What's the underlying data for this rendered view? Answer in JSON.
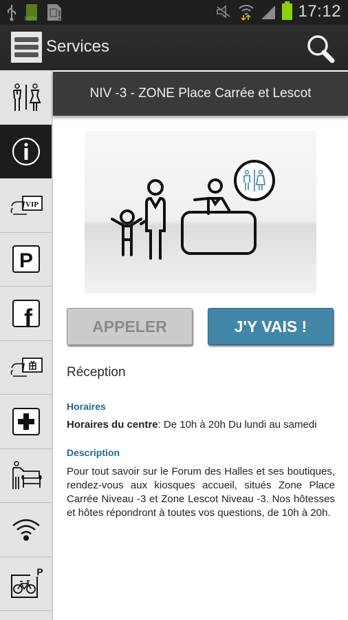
{
  "status_bar": {
    "battery_small_label": "100%",
    "time": "17:12",
    "icons": [
      "usb-icon",
      "battery-icon",
      "sim-alert-icon",
      "mute-icon",
      "wifi-icon",
      "signal-icon",
      "battery-icon"
    ]
  },
  "action_bar": {
    "title": "Services",
    "menu_icon": "hamburger-icon",
    "search_icon": "search-icon"
  },
  "sidebar": {
    "items": [
      {
        "id": "toilets",
        "icon": "toilets-icon"
      },
      {
        "id": "info",
        "icon": "info-icon",
        "active": true
      },
      {
        "id": "vip",
        "icon": "vip-card-icon",
        "text": "VIP"
      },
      {
        "id": "parking",
        "icon": "parking-icon",
        "text": "P"
      },
      {
        "id": "facebook",
        "icon": "facebook-icon",
        "text": "f"
      },
      {
        "id": "gift-card",
        "icon": "gift-card-icon"
      },
      {
        "id": "first-aid",
        "icon": "first-aid-icon"
      },
      {
        "id": "lounge",
        "icon": "lounge-icon"
      },
      {
        "id": "wifi",
        "icon": "wifi-icon"
      },
      {
        "id": "bike-parking",
        "icon": "bike-parking-icon",
        "text": "P"
      }
    ]
  },
  "header": {
    "location": "NIV -3 - ZONE Place Carrée et Lescot"
  },
  "actions": {
    "call_label": "APPELER",
    "go_label": "J'Y VAIS !"
  },
  "details": {
    "title": "Réception",
    "hours_heading": "Horaires",
    "hours_label": "Horaires du centre",
    "hours_value": ": De 10h à 20h Du lundi au samedi",
    "description_heading": "Description",
    "description": "Pour tout savoir sur le Forum des Halles et ses boutiques, rendez-vous aux kiosques accueil, situés Zone Place Carrée Niveau -3 et Zone Lescot Niveau -3. Nos hôtesses et hôtes répondront à toutes vos questions, de 10h à 20h."
  },
  "colors": {
    "accent": "#4387a8",
    "heading_blue": "#1f6a8c",
    "battery_green": "#8ed000"
  }
}
